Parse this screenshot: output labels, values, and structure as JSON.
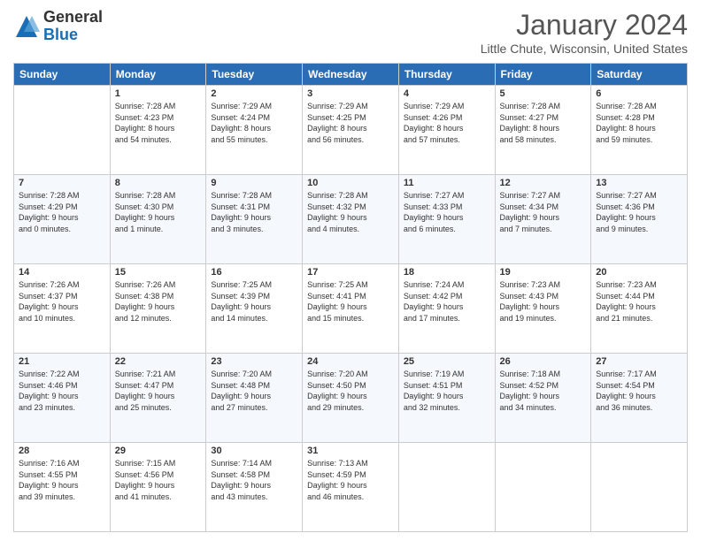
{
  "header": {
    "logo_general": "General",
    "logo_blue": "Blue",
    "title": "January 2024",
    "location": "Little Chute, Wisconsin, United States"
  },
  "days_of_week": [
    "Sunday",
    "Monday",
    "Tuesday",
    "Wednesday",
    "Thursday",
    "Friday",
    "Saturday"
  ],
  "weeks": [
    [
      {
        "day": "",
        "info": ""
      },
      {
        "day": "1",
        "info": "Sunrise: 7:28 AM\nSunset: 4:23 PM\nDaylight: 8 hours\nand 54 minutes."
      },
      {
        "day": "2",
        "info": "Sunrise: 7:29 AM\nSunset: 4:24 PM\nDaylight: 8 hours\nand 55 minutes."
      },
      {
        "day": "3",
        "info": "Sunrise: 7:29 AM\nSunset: 4:25 PM\nDaylight: 8 hours\nand 56 minutes."
      },
      {
        "day": "4",
        "info": "Sunrise: 7:29 AM\nSunset: 4:26 PM\nDaylight: 8 hours\nand 57 minutes."
      },
      {
        "day": "5",
        "info": "Sunrise: 7:28 AM\nSunset: 4:27 PM\nDaylight: 8 hours\nand 58 minutes."
      },
      {
        "day": "6",
        "info": "Sunrise: 7:28 AM\nSunset: 4:28 PM\nDaylight: 8 hours\nand 59 minutes."
      }
    ],
    [
      {
        "day": "7",
        "info": "Sunrise: 7:28 AM\nSunset: 4:29 PM\nDaylight: 9 hours\nand 0 minutes."
      },
      {
        "day": "8",
        "info": "Sunrise: 7:28 AM\nSunset: 4:30 PM\nDaylight: 9 hours\nand 1 minute."
      },
      {
        "day": "9",
        "info": "Sunrise: 7:28 AM\nSunset: 4:31 PM\nDaylight: 9 hours\nand 3 minutes."
      },
      {
        "day": "10",
        "info": "Sunrise: 7:28 AM\nSunset: 4:32 PM\nDaylight: 9 hours\nand 4 minutes."
      },
      {
        "day": "11",
        "info": "Sunrise: 7:27 AM\nSunset: 4:33 PM\nDaylight: 9 hours\nand 6 minutes."
      },
      {
        "day": "12",
        "info": "Sunrise: 7:27 AM\nSunset: 4:34 PM\nDaylight: 9 hours\nand 7 minutes."
      },
      {
        "day": "13",
        "info": "Sunrise: 7:27 AM\nSunset: 4:36 PM\nDaylight: 9 hours\nand 9 minutes."
      }
    ],
    [
      {
        "day": "14",
        "info": "Sunrise: 7:26 AM\nSunset: 4:37 PM\nDaylight: 9 hours\nand 10 minutes."
      },
      {
        "day": "15",
        "info": "Sunrise: 7:26 AM\nSunset: 4:38 PM\nDaylight: 9 hours\nand 12 minutes."
      },
      {
        "day": "16",
        "info": "Sunrise: 7:25 AM\nSunset: 4:39 PM\nDaylight: 9 hours\nand 14 minutes."
      },
      {
        "day": "17",
        "info": "Sunrise: 7:25 AM\nSunset: 4:41 PM\nDaylight: 9 hours\nand 15 minutes."
      },
      {
        "day": "18",
        "info": "Sunrise: 7:24 AM\nSunset: 4:42 PM\nDaylight: 9 hours\nand 17 minutes."
      },
      {
        "day": "19",
        "info": "Sunrise: 7:23 AM\nSunset: 4:43 PM\nDaylight: 9 hours\nand 19 minutes."
      },
      {
        "day": "20",
        "info": "Sunrise: 7:23 AM\nSunset: 4:44 PM\nDaylight: 9 hours\nand 21 minutes."
      }
    ],
    [
      {
        "day": "21",
        "info": "Sunrise: 7:22 AM\nSunset: 4:46 PM\nDaylight: 9 hours\nand 23 minutes."
      },
      {
        "day": "22",
        "info": "Sunrise: 7:21 AM\nSunset: 4:47 PM\nDaylight: 9 hours\nand 25 minutes."
      },
      {
        "day": "23",
        "info": "Sunrise: 7:20 AM\nSunset: 4:48 PM\nDaylight: 9 hours\nand 27 minutes."
      },
      {
        "day": "24",
        "info": "Sunrise: 7:20 AM\nSunset: 4:50 PM\nDaylight: 9 hours\nand 29 minutes."
      },
      {
        "day": "25",
        "info": "Sunrise: 7:19 AM\nSunset: 4:51 PM\nDaylight: 9 hours\nand 32 minutes."
      },
      {
        "day": "26",
        "info": "Sunrise: 7:18 AM\nSunset: 4:52 PM\nDaylight: 9 hours\nand 34 minutes."
      },
      {
        "day": "27",
        "info": "Sunrise: 7:17 AM\nSunset: 4:54 PM\nDaylight: 9 hours\nand 36 minutes."
      }
    ],
    [
      {
        "day": "28",
        "info": "Sunrise: 7:16 AM\nSunset: 4:55 PM\nDaylight: 9 hours\nand 39 minutes."
      },
      {
        "day": "29",
        "info": "Sunrise: 7:15 AM\nSunset: 4:56 PM\nDaylight: 9 hours\nand 41 minutes."
      },
      {
        "day": "30",
        "info": "Sunrise: 7:14 AM\nSunset: 4:58 PM\nDaylight: 9 hours\nand 43 minutes."
      },
      {
        "day": "31",
        "info": "Sunrise: 7:13 AM\nSunset: 4:59 PM\nDaylight: 9 hours\nand 46 minutes."
      },
      {
        "day": "",
        "info": ""
      },
      {
        "day": "",
        "info": ""
      },
      {
        "day": "",
        "info": ""
      }
    ]
  ]
}
